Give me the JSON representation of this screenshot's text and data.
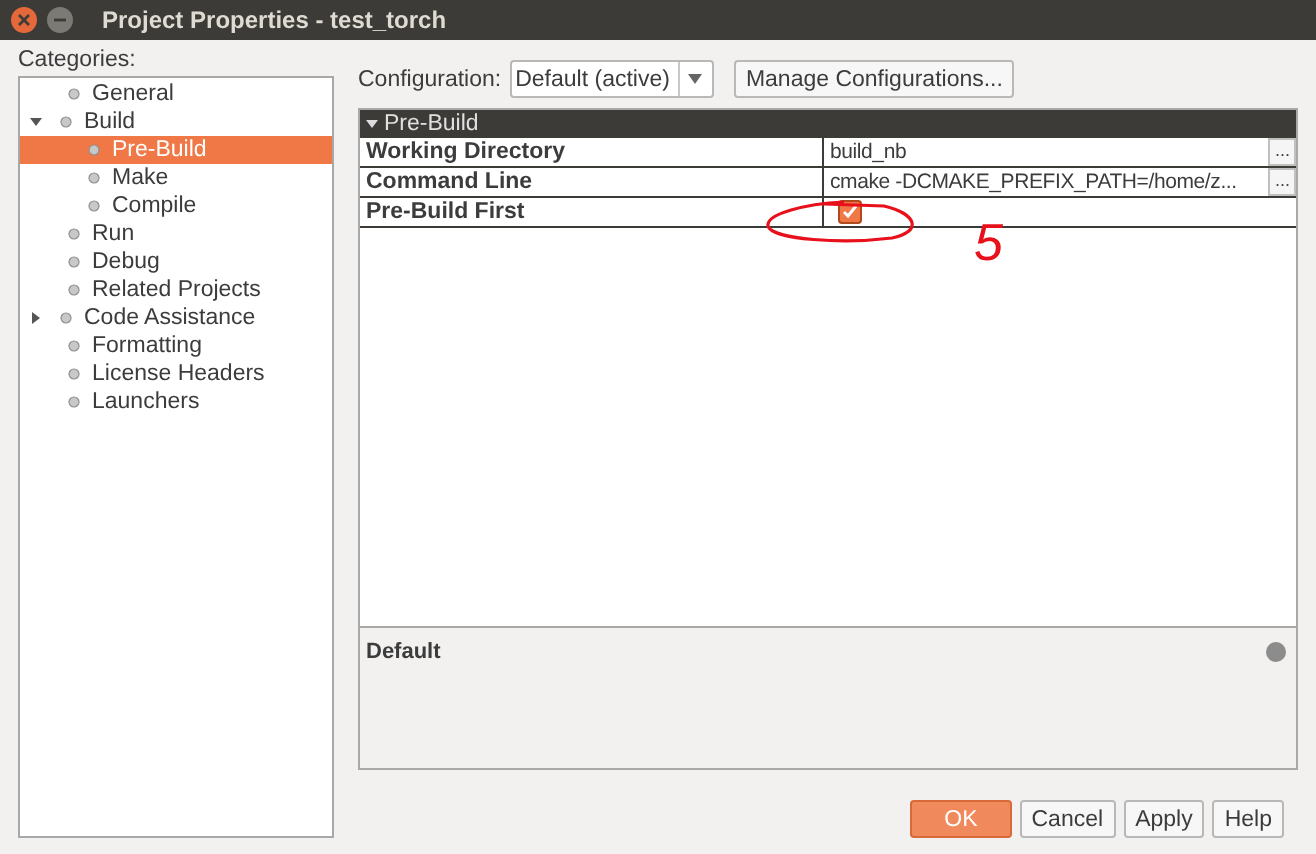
{
  "window": {
    "title": "Project Properties - test_torch"
  },
  "categories": {
    "label": "Categories:",
    "items": [
      {
        "label": "General",
        "selected": false
      },
      {
        "label": "Build",
        "selected": false,
        "expanded": true,
        "children": [
          {
            "label": "Pre-Build",
            "selected": true
          },
          {
            "label": "Make",
            "selected": false
          },
          {
            "label": "Compile",
            "selected": false
          }
        ]
      },
      {
        "label": "Run",
        "selected": false
      },
      {
        "label": "Debug",
        "selected": false
      },
      {
        "label": "Related Projects",
        "selected": false
      },
      {
        "label": "Code Assistance",
        "selected": false,
        "expanded": false
      },
      {
        "label": "Formatting",
        "selected": false
      },
      {
        "label": "License Headers",
        "selected": false
      },
      {
        "label": "Launchers",
        "selected": false
      }
    ]
  },
  "configuration": {
    "label": "Configuration:",
    "value": "Default (active)",
    "manage_button": "Manage Configurations..."
  },
  "property_sheet": {
    "section": "Pre-Build",
    "rows": [
      {
        "kind": "text",
        "name": "Working Directory",
        "value": "build_nb",
        "button": "..."
      },
      {
        "kind": "text",
        "name": "Command Line",
        "value": "cmake -DCMAKE_PREFIX_PATH=/home/z...",
        "button": "..."
      },
      {
        "kind": "checkbox",
        "name": "Pre-Build First",
        "checked": true
      }
    ]
  },
  "description": {
    "title": "Default"
  },
  "annotation": {
    "mark": "5"
  },
  "buttons": [
    {
      "label": "OK",
      "default": true
    },
    {
      "label": "Cancel",
      "default": false
    },
    {
      "label": "Apply",
      "default": false
    },
    {
      "label": "Help",
      "default": false
    }
  ]
}
